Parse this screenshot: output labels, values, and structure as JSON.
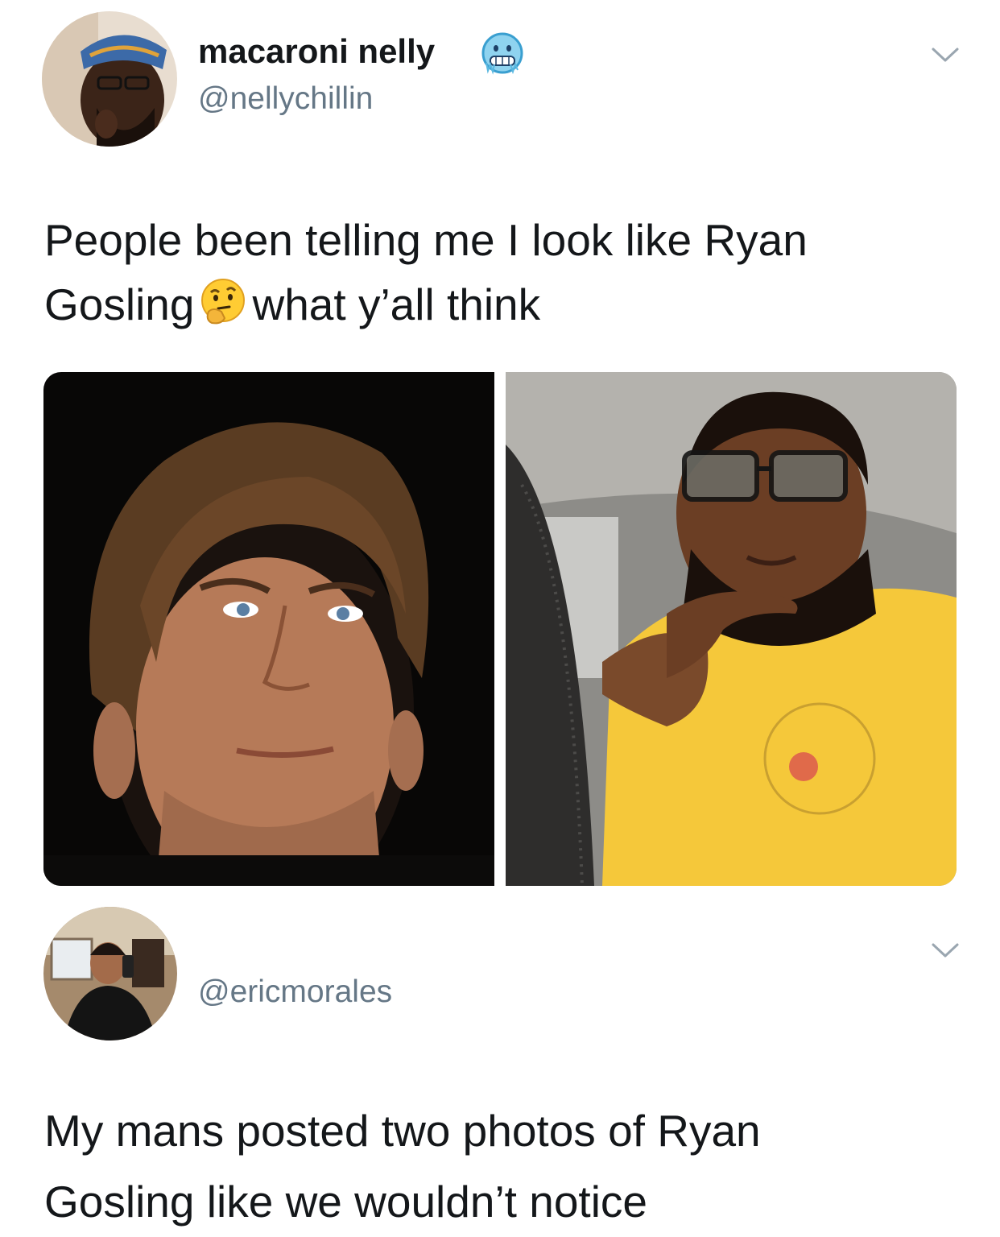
{
  "tweet": {
    "display_name": "macaroni nelly",
    "handle": "@nellychillin",
    "emoji_icon": "cold-face-icon",
    "text_line1": "People been telling me I look like Ryan",
    "text_line2_a": "Gosling",
    "text_line2_emoji": "thinking-face-icon",
    "text_line2_b": "what y’all think",
    "photos": [
      "photo-man-dark-background",
      "photo-man-car-selfie"
    ]
  },
  "reply": {
    "handle": "@ericmorales",
    "text_line1": "My mans posted two photos of Ryan",
    "text_line2": "Gosling like we wouldn’t notice"
  },
  "colors": {
    "text": "#14171a",
    "secondary": "#657786",
    "shirt": "#f5c83a"
  }
}
